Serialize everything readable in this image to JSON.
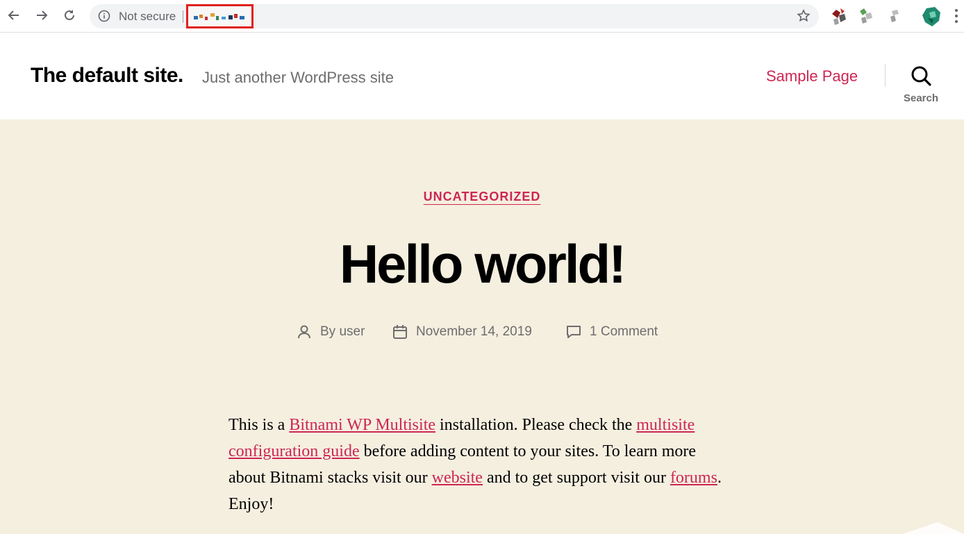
{
  "browser": {
    "security_text": "Not secure"
  },
  "site": {
    "title": "The default site.",
    "description": "Just another WordPress site",
    "nav": [
      {
        "label": "Sample Page"
      }
    ],
    "search_label": "Search"
  },
  "post": {
    "category": "UNCATEGORIZED",
    "title": "Hello world!",
    "author": "By user",
    "date": "November 14, 2019",
    "comments": "1 Comment",
    "content": {
      "t1": "This is a ",
      "link1": "Bitnami WP Multisite",
      "t2": " installation. Please check the ",
      "link2": "multisite configuration guide",
      "t3": " before adding content to your sites. To learn more about Bitnami stacks visit our ",
      "link3": "website",
      "t4": " and to get support visit our ",
      "link4": "forums",
      "t5": ". Enjoy!"
    }
  },
  "colors": {
    "accent": "#cd2653",
    "background": "#f5efe0",
    "highlight_box": "#e0201c"
  }
}
